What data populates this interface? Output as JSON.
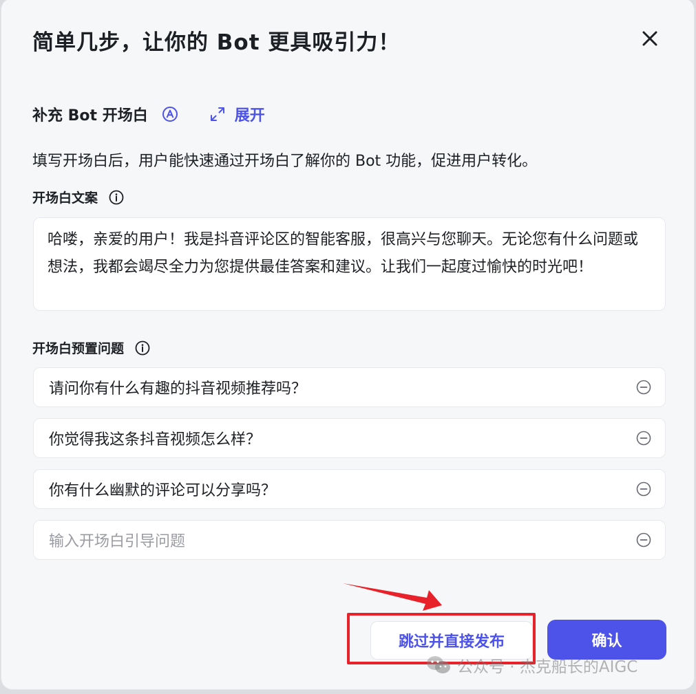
{
  "dialog": {
    "title": "简单几步，让你的 Bot 更具吸引力！",
    "close_icon": "close-icon"
  },
  "section": {
    "title": "补充 Bot 开场白",
    "auto_icon": "auto-generate-icon",
    "expand_icon": "expand-arrows-icon",
    "expand_label": "展开",
    "description": "填写开场白后，用户能快速通过开场白了解你的 Bot 功能，促进用户转化。"
  },
  "opening": {
    "label": "开场白文案",
    "info_icon": "info-icon",
    "text": "哈喽，亲爱的用户！我是抖音评论区的智能客服，很高兴与您聊天。无论您有什么问题或想法，我都会竭尽全力为您提供最佳答案和建议。让我们一起度过愉快的时光吧！"
  },
  "preset_questions": {
    "label": "开场白预置问题",
    "info_icon": "info-icon",
    "items": [
      {
        "text": "请问你有什么有趣的抖音视频推荐吗？"
      },
      {
        "text": "你觉得我这条抖音视频怎么样？"
      },
      {
        "text": "你有什么幽默的评论可以分享吗？"
      }
    ],
    "input_placeholder": "输入开场白引导问题",
    "remove_icon": "remove-circle-icon"
  },
  "footer": {
    "skip_label": "跳过并直接发布",
    "confirm_label": "确认"
  },
  "watermark": {
    "text": "公众号 · 杰克船长的AIGC",
    "icon": "wechat-icon"
  },
  "colors": {
    "accent": "#4d53e8",
    "annotation_red": "#e8222a",
    "dialog_bg": "#f6f7f9"
  }
}
